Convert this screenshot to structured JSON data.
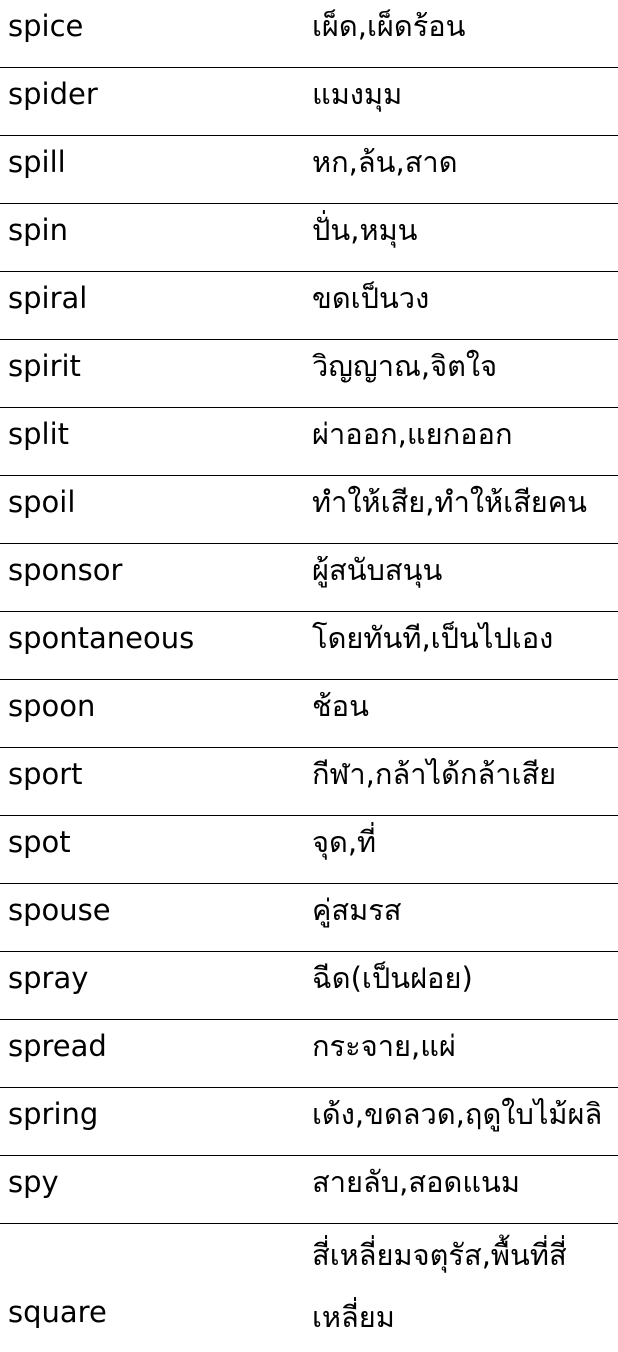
{
  "entries": [
    {
      "word": "spice",
      "meaning": "เผ็ด,เผ็ดร้อน"
    },
    {
      "word": "spider",
      "meaning": "แมงมุม"
    },
    {
      "word": "spill",
      "meaning": "หก,ล้น,สาด"
    },
    {
      "word": "spin",
      "meaning": "ปั่น,หมุน"
    },
    {
      "word": "spiral",
      "meaning": "ขดเป็นวง"
    },
    {
      "word": "spirit",
      "meaning": "วิญญาณ,จิตใจ"
    },
    {
      "word": "split",
      "meaning": "ผ่าออก,แยกออก"
    },
    {
      "word": "spoil",
      "meaning": "ทำให้เสีย,ทำให้เสียคน"
    },
    {
      "word": "sponsor",
      "meaning": "ผู้สนับสนุน"
    },
    {
      "word": "spontaneous",
      "meaning": "โดยทันที,เป็นไปเอง"
    },
    {
      "word": "spoon",
      "meaning": "ช้อน"
    },
    {
      "word": "sport",
      "meaning": "กีฬา,กล้าได้กล้าเสีย"
    },
    {
      "word": "spot",
      "meaning": "จุด,ที่"
    },
    {
      "word": "spouse",
      "meaning": "คู่สมรส"
    },
    {
      "word": "spray",
      "meaning": "ฉีด(เป็นฝอย)"
    },
    {
      "word": "spread",
      "meaning": "กระจาย,แผ่"
    },
    {
      "word": "spring",
      "meaning": "เด้ง,ขดลวด,ฤดูใบไม้ผลิ"
    },
    {
      "word": "spy",
      "meaning": "สายลับ,สอดแนม"
    }
  ],
  "last_entry": {
    "word": "square",
    "meaning_line1": "สี่เหลี่ยมจตุรัส,พื้นที่สี่",
    "meaning_line2": "เหลี่ยม"
  }
}
